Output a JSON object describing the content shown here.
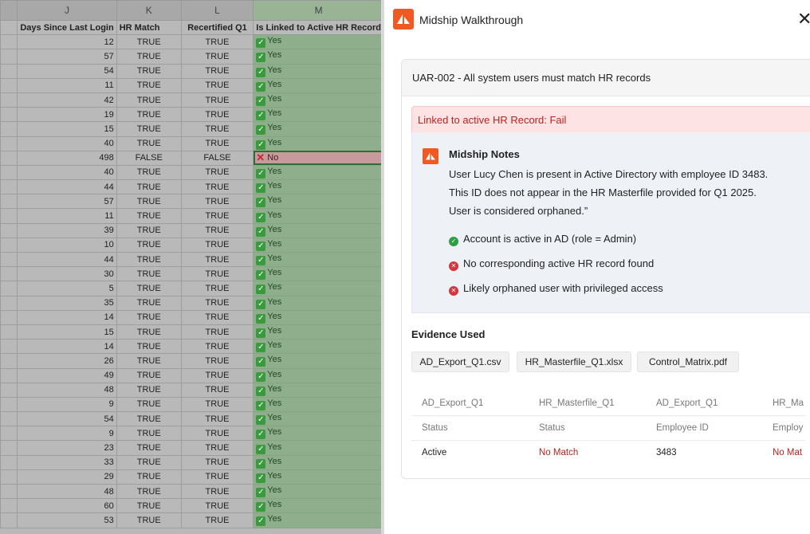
{
  "sheet": {
    "columns": [
      "J",
      "K",
      "L",
      "M"
    ],
    "headers": [
      "Days Since Last Login",
      "HR Match",
      "Recertified Q1",
      "Is Linked to Active HR Record"
    ],
    "rows": [
      {
        "days": "12",
        "hr": "TRUE",
        "recert": "TRUE",
        "linked": "Yes"
      },
      {
        "days": "57",
        "hr": "TRUE",
        "recert": "TRUE",
        "linked": "Yes"
      },
      {
        "days": "54",
        "hr": "TRUE",
        "recert": "TRUE",
        "linked": "Yes"
      },
      {
        "days": "11",
        "hr": "TRUE",
        "recert": "TRUE",
        "linked": "Yes"
      },
      {
        "days": "42",
        "hr": "TRUE",
        "recert": "TRUE",
        "linked": "Yes"
      },
      {
        "days": "19",
        "hr": "TRUE",
        "recert": "TRUE",
        "linked": "Yes"
      },
      {
        "days": "15",
        "hr": "TRUE",
        "recert": "TRUE",
        "linked": "Yes"
      },
      {
        "days": "40",
        "hr": "TRUE",
        "recert": "TRUE",
        "linked": "Yes"
      },
      {
        "days": "498",
        "hr": "FALSE",
        "recert": "FALSE",
        "linked": "No"
      },
      {
        "days": "40",
        "hr": "TRUE",
        "recert": "TRUE",
        "linked": "Yes"
      },
      {
        "days": "44",
        "hr": "TRUE",
        "recert": "TRUE",
        "linked": "Yes"
      },
      {
        "days": "57",
        "hr": "TRUE",
        "recert": "TRUE",
        "linked": "Yes"
      },
      {
        "days": "11",
        "hr": "TRUE",
        "recert": "TRUE",
        "linked": "Yes"
      },
      {
        "days": "39",
        "hr": "TRUE",
        "recert": "TRUE",
        "linked": "Yes"
      },
      {
        "days": "10",
        "hr": "TRUE",
        "recert": "TRUE",
        "linked": "Yes"
      },
      {
        "days": "44",
        "hr": "TRUE",
        "recert": "TRUE",
        "linked": "Yes"
      },
      {
        "days": "30",
        "hr": "TRUE",
        "recert": "TRUE",
        "linked": "Yes"
      },
      {
        "days": "5",
        "hr": "TRUE",
        "recert": "TRUE",
        "linked": "Yes"
      },
      {
        "days": "35",
        "hr": "TRUE",
        "recert": "TRUE",
        "linked": "Yes"
      },
      {
        "days": "14",
        "hr": "TRUE",
        "recert": "TRUE",
        "linked": "Yes"
      },
      {
        "days": "15",
        "hr": "TRUE",
        "recert": "TRUE",
        "linked": "Yes"
      },
      {
        "days": "14",
        "hr": "TRUE",
        "recert": "TRUE",
        "linked": "Yes"
      },
      {
        "days": "26",
        "hr": "TRUE",
        "recert": "TRUE",
        "linked": "Yes"
      },
      {
        "days": "49",
        "hr": "TRUE",
        "recert": "TRUE",
        "linked": "Yes"
      },
      {
        "days": "48",
        "hr": "TRUE",
        "recert": "TRUE",
        "linked": "Yes"
      },
      {
        "days": "9",
        "hr": "TRUE",
        "recert": "TRUE",
        "linked": "Yes"
      },
      {
        "days": "54",
        "hr": "TRUE",
        "recert": "TRUE",
        "linked": "Yes"
      },
      {
        "days": "9",
        "hr": "TRUE",
        "recert": "TRUE",
        "linked": "Yes"
      },
      {
        "days": "23",
        "hr": "TRUE",
        "recert": "TRUE",
        "linked": "Yes"
      },
      {
        "days": "33",
        "hr": "TRUE",
        "recert": "TRUE",
        "linked": "Yes"
      },
      {
        "days": "29",
        "hr": "TRUE",
        "recert": "TRUE",
        "linked": "Yes"
      },
      {
        "days": "48",
        "hr": "TRUE",
        "recert": "TRUE",
        "linked": "Yes"
      },
      {
        "days": "60",
        "hr": "TRUE",
        "recert": "TRUE",
        "linked": "Yes"
      },
      {
        "days": "53",
        "hr": "TRUE",
        "recert": "TRUE",
        "linked": "Yes"
      }
    ],
    "yes_icon": "check-icon",
    "no_icon": "x-icon",
    "colors": {
      "linked_column": "#8fae8c",
      "fail_cell": "#c79a9e"
    }
  },
  "panel": {
    "title": "Midship Walkthrough",
    "close_icon": "close-icon",
    "control_title": "UAR-002 - All system users must match HR records",
    "fail_banner": "Linked to active HR Record: Fail",
    "notes": {
      "title": "Midship Notes",
      "body_lines": [
        "User Lucy Chen is present in Active Directory with employee ID 3483.",
        "This ID does not appear in the HR Masterfile provided for Q1 2025.",
        "User is considered orphaned.”"
      ],
      "bullets": [
        {
          "status": "ok",
          "text": "Account is active in AD (role = Admin)"
        },
        {
          "status": "bad",
          "text": "No corresponding active HR record found"
        },
        {
          "status": "bad",
          "text": "Likely orphaned user with privileged access"
        }
      ]
    },
    "evidence": {
      "heading": "Evidence Used",
      "files": [
        "AD_Export_Q1.csv",
        "HR_Masterfile_Q1.xlsx",
        "Control_Matrix.pdf"
      ],
      "table": {
        "sources": [
          "AD_Export_Q1",
          "HR_Masterfile_Q1",
          "AD_Export_Q1",
          "HR_Ma"
        ],
        "fields": [
          "Status",
          "Status",
          "Employee ID",
          "Employ"
        ],
        "values": [
          "Active",
          "No Match",
          "3483",
          "No Mat"
        ]
      }
    },
    "colors": {
      "brand": "#f05a22",
      "fail_text": "#b3261e",
      "fail_bg": "#fde3e3",
      "ok": "#2e9e44",
      "bad": "#d6353b"
    }
  }
}
